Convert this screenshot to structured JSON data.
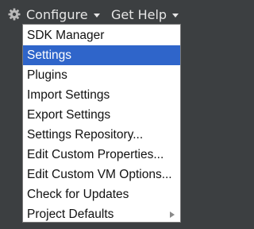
{
  "toolbar": {
    "configure_label": "Configure",
    "configure_icon": "gear-icon",
    "get_help_label": "Get Help"
  },
  "menu": {
    "selected_index": 1,
    "selected_color": "#2f65ca",
    "items": [
      {
        "label": "SDK Manager"
      },
      {
        "label": "Settings"
      },
      {
        "label": "Plugins"
      },
      {
        "label": "Import Settings"
      },
      {
        "label": "Export Settings"
      },
      {
        "label": "Settings Repository..."
      },
      {
        "label": "Edit Custom Properties..."
      },
      {
        "label": "Edit Custom VM Options..."
      },
      {
        "label": "Check for Updates"
      },
      {
        "label": "Project Defaults",
        "has_submenu": true
      }
    ]
  }
}
